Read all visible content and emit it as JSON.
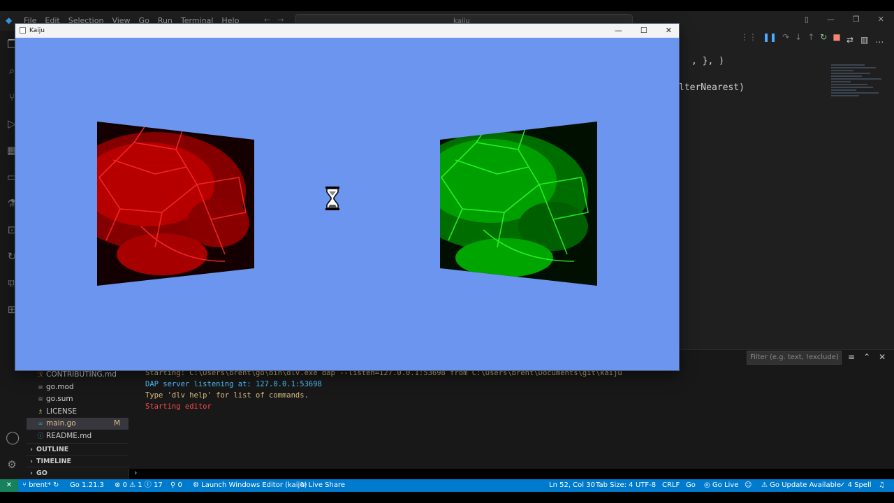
{
  "vscode": {
    "menu": [
      "File",
      "Edit",
      "Selection",
      "View",
      "Go",
      "Run",
      "Terminal",
      "Help"
    ],
    "search": "kaiju",
    "code_lines": [
      ", }, )",
      "lterNearest)"
    ],
    "explorer_files": [
      {
        "label": "CONTRIBUTING.md",
        "icon": "markdown-file-icon"
      },
      {
        "label": "go.mod",
        "icon": "lines-file-icon"
      },
      {
        "label": "go.sum",
        "icon": "lines-file-icon"
      },
      {
        "label": "LICENSE",
        "icon": "license-file-icon"
      },
      {
        "label": "main.go",
        "icon": "go-file-icon",
        "badge": "M"
      },
      {
        "label": "README.md",
        "icon": "info-file-icon"
      }
    ],
    "sections": [
      "OUTLINE",
      "TIMELINE",
      "GO"
    ],
    "panel_filter_placeholder": "Filter (e.g. text, !exclude)",
    "terminal": [
      {
        "text": "Starting: C:\\Users\\brent\\go\\bin\\dlv.exe dap --listen=127.0.0.1:53698 from C:\\Users\\brent\\Documents\\git\\kaiju",
        "color": "#d7ba7d"
      },
      {
        "text": "DAP server listening at: 127.0.0.1:53698",
        "color": "#4fc1ff"
      },
      {
        "text": "Type 'dlv help' for list of commands.",
        "color": "#d7ba7d"
      },
      {
        "text": "Starting editor",
        "color": "#f14c4c"
      }
    ],
    "status_bar": {
      "remote": "✕",
      "branch": "brent*",
      "go_version": "Go 1.21.3",
      "problems": "0 ⚠ 1 ⓘ 17",
      "ports": "0",
      "launch": "Launch Windows Editor (kaiju)",
      "live_share": "Live Share",
      "cursor": "Ln 52, Col 30",
      "tab_size": "Tab Size: 4",
      "encoding": "UTF-8",
      "eol": "CRLF",
      "language": "Go",
      "go_live": "Go Live",
      "go_update": "Go Update Available",
      "spell": "4 Spell"
    }
  },
  "kaiju_window": {
    "title": "Kaiju",
    "controls": [
      "—",
      "☐",
      "✕"
    ],
    "background": "#6b95ee",
    "left_tint": "#e00000",
    "right_tint": "#00d020"
  }
}
